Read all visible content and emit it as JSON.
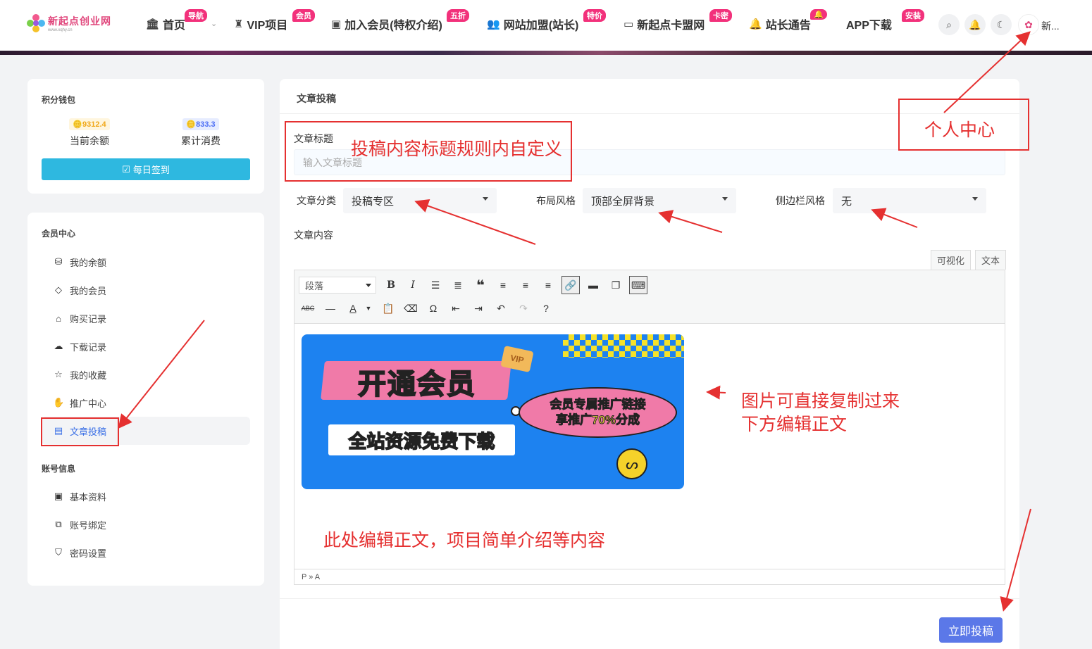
{
  "brand": {
    "logo_text": "新起点创业网",
    "logo_sub": "www.xqhy.cn"
  },
  "nav": [
    {
      "label": "首页",
      "icon": "bank-icon",
      "badge": "导航"
    },
    {
      "label": "VIP项目",
      "icon": "user-secret-icon",
      "badge": "会员"
    },
    {
      "label": "加入会员(特权介绍)",
      "icon": "vimeo-icon",
      "badge": "五折"
    },
    {
      "label": "网站加盟(站长)",
      "icon": "users-icon",
      "badge": "特价"
    },
    {
      "label": "新起点卡盟网",
      "icon": "credit-card-icon",
      "badge": "卡密"
    },
    {
      "label": "站长通告",
      "icon": "bell-icon",
      "badge": "🔔"
    },
    {
      "label": "APP下载",
      "icon": "apple-icon",
      "badge": "安装"
    }
  ],
  "header": {
    "user_name": "新..."
  },
  "wallet": {
    "title": "积分钱包",
    "balance_value": "9312.4",
    "balance_label": "当前余额",
    "spent_value": "833.3",
    "spent_label": "累计消费",
    "checkin_label": "每日签到"
  },
  "member_center": {
    "title": "会员中心",
    "items": [
      {
        "label": "我的余额",
        "icon": "coins-icon"
      },
      {
        "label": "我的会员",
        "icon": "diamond-icon"
      },
      {
        "label": "购买记录",
        "icon": "basket-icon"
      },
      {
        "label": "下载记录",
        "icon": "cloud-download-icon"
      },
      {
        "label": "我的收藏",
        "icon": "star-icon"
      },
      {
        "label": "推广中心",
        "icon": "hand-coin-icon"
      },
      {
        "label": "文章投稿",
        "icon": "newspaper-icon"
      }
    ]
  },
  "account_info": {
    "title": "账号信息",
    "items": [
      {
        "label": "基本资料",
        "icon": "id-card-icon"
      },
      {
        "label": "账号绑定",
        "icon": "link-icon"
      },
      {
        "label": "密码设置",
        "icon": "shield-icon"
      }
    ]
  },
  "post_form": {
    "heading": "文章投稿",
    "title_label": "文章标题",
    "title_placeholder": "输入文章标题",
    "category_label": "文章分类",
    "category_value": "投稿专区",
    "layout_label": "布局风格",
    "layout_value": "顶部全屏背景",
    "sidebar_label": "侧边栏风格",
    "sidebar_value": "无",
    "content_label": "文章内容",
    "tab_visual": "可视化",
    "tab_text": "文本",
    "format_select": "段落",
    "statusbar_path": "P » A",
    "submit_label": "立即投稿"
  },
  "promo_image": {
    "title": "开通会员",
    "oval_line1": "会员专属推广链接",
    "oval_line2": "享推广70%分成",
    "bar_text": "全站资源免费下载",
    "ticket": "VIP"
  },
  "annotations": {
    "title_rule": "投稿内容标题规则内自定义",
    "personal_center": "个人中心",
    "image_line1": "图片可直接复制过来",
    "image_line2": "下方编辑正文",
    "body_hint": "此处编辑正文，项目简单介绍等内容",
    "color": "#e53030"
  },
  "colors": {
    "accent": "#3a6fe6",
    "checkin": "#2eb8e0",
    "submit": "#5b78e8",
    "badge": "#f2317b"
  }
}
